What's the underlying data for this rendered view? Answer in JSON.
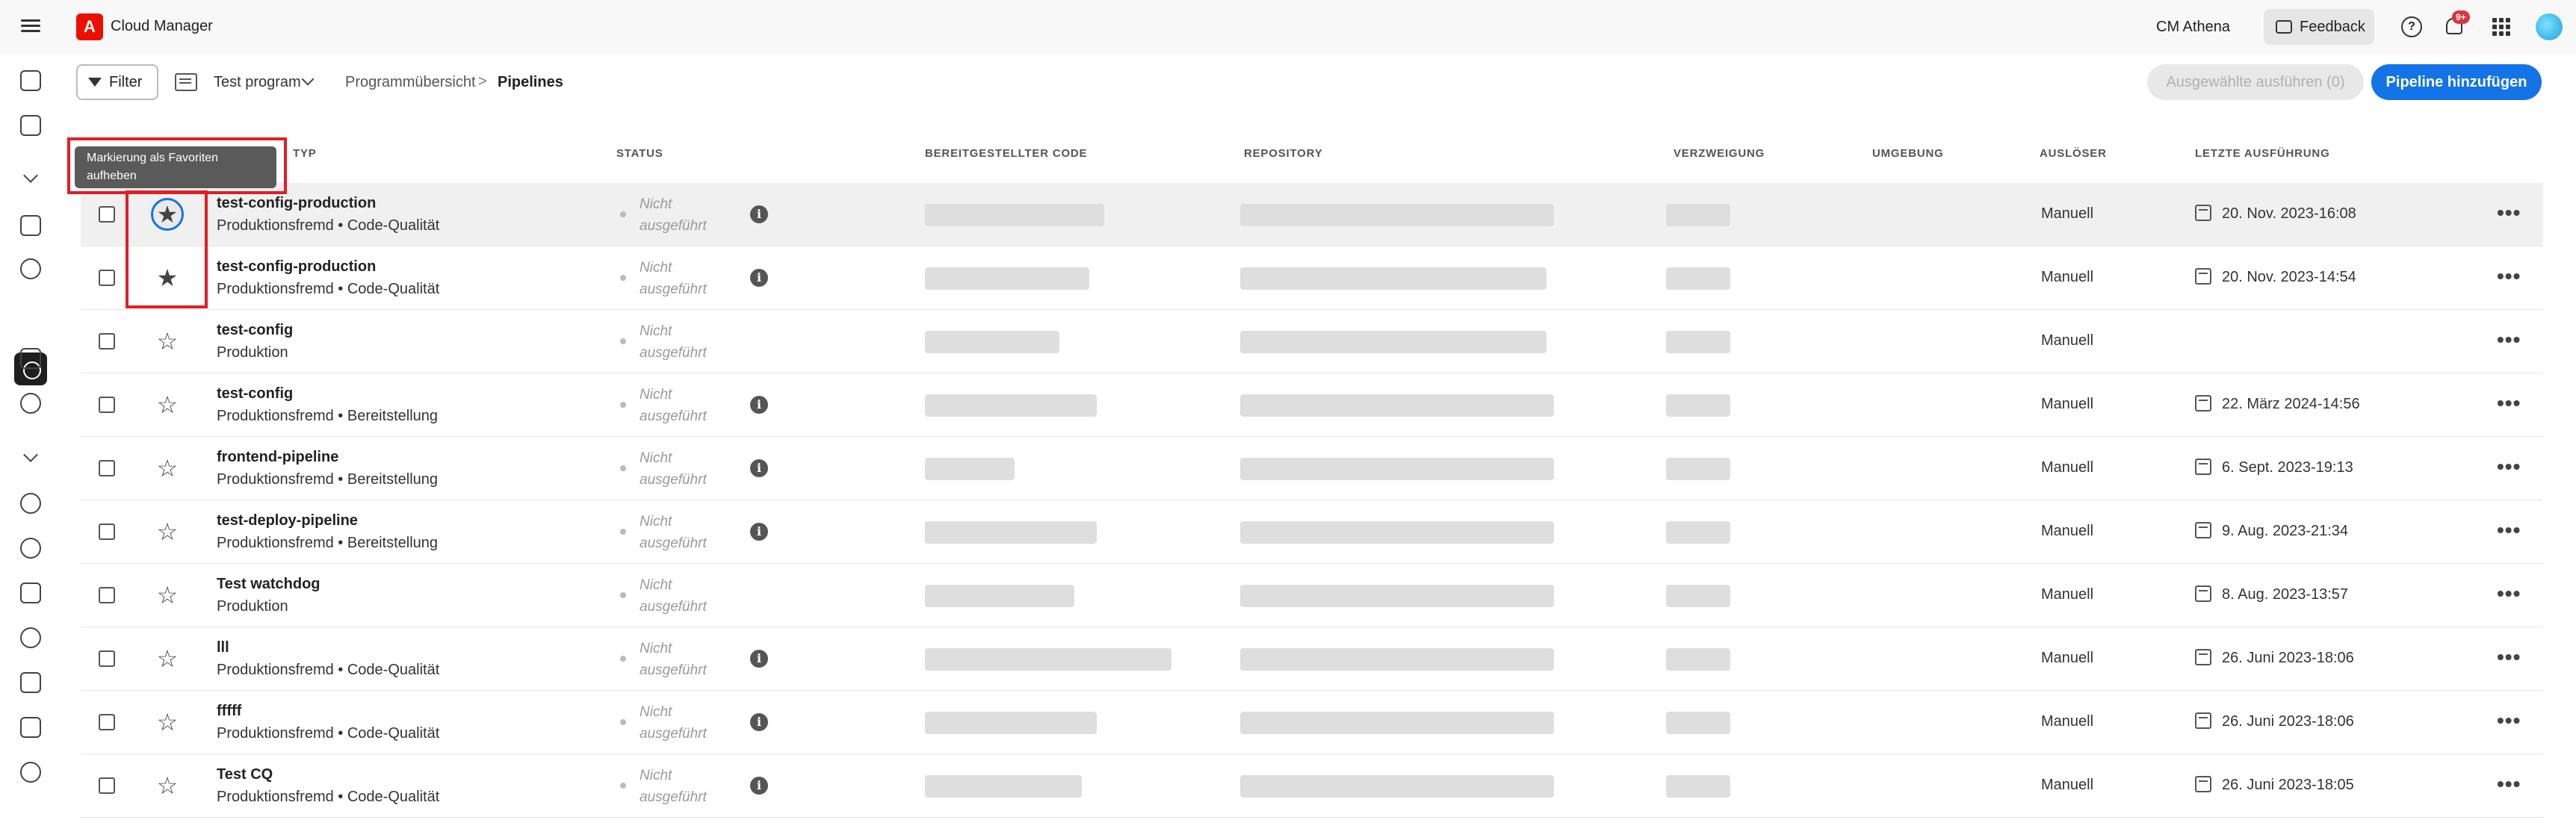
{
  "header": {
    "app_title": "Cloud Manager",
    "org_name": "CM Athena",
    "feedback_label": "Feedback",
    "notification_badge": "9+"
  },
  "toolbar": {
    "filter_label": "Filter",
    "program_name": "Test program",
    "breadcrumb_parent": "Programmübersicht",
    "breadcrumb_separator": ">",
    "breadcrumb_current": "Pipelines",
    "run_selected_label": "Ausgewählte ausführen (0)",
    "add_pipeline_label": "Pipeline hinzufügen"
  },
  "tooltip": {
    "text": "Markierung als Favoriten aufheben"
  },
  "table": {
    "columns": {
      "type": "TYP",
      "status": "STATUS",
      "deployed_code": "BEREITGESTELLTER CODE",
      "repository": "REPOSITORY",
      "branch": "VERZWEIGUNG",
      "environment": "UMGEBUNG",
      "trigger": "AUSLÖSER",
      "last_run": "LETZTE AUSFÜHRUNG"
    },
    "rows": [
      {
        "name": "test-config-production",
        "type": "Produktionsfremd • Code-Qualität",
        "status": "Nicht ausgeführt",
        "trigger": "Manuell",
        "last_run": "20. Nov. 2023-16:08",
        "favorite": true
      },
      {
        "name": "test-config-production",
        "type": "Produktionsfremd • Code-Qualität",
        "status": "Nicht ausgeführt",
        "trigger": "Manuell",
        "last_run": "20. Nov. 2023-14:54",
        "favorite": true
      },
      {
        "name": "test-config",
        "type": "Produktion",
        "status": "Nicht ausgeführt",
        "trigger": "Manuell",
        "last_run": "",
        "favorite": false
      },
      {
        "name": "test-config",
        "type": "Produktionsfremd • Bereitstellung",
        "status": "Nicht ausgeführt",
        "trigger": "Manuell",
        "last_run": "22. März 2024-14:56",
        "favorite": false
      },
      {
        "name": "frontend-pipeline",
        "type": "Produktionsfremd • Bereitstellung",
        "status": "Nicht ausgeführt",
        "trigger": "Manuell",
        "last_run": "6. Sept. 2023-19:13",
        "favorite": false
      },
      {
        "name": "test-deploy-pipeline",
        "type": "Produktionsfremd • Bereitstellung",
        "status": "Nicht ausgeführt",
        "trigger": "Manuell",
        "last_run": "9. Aug. 2023-21:34",
        "favorite": false
      },
      {
        "name": "Test watchdog",
        "type": "Produktion",
        "status": "Nicht ausgeführt",
        "trigger": "Manuell",
        "last_run": "8. Aug. 2023-13:57",
        "favorite": false
      },
      {
        "name": "lll",
        "type": "Produktionsfremd • Code-Qualität",
        "status": "Nicht ausgeführt",
        "trigger": "Manuell",
        "last_run": "26. Juni 2023-18:06",
        "favorite": false
      },
      {
        "name": "fffff",
        "type": "Produktionsfremd • Code-Qualität",
        "status": "Nicht ausgeführt",
        "trigger": "Manuell",
        "last_run": "26. Juni 2023-18:06",
        "favorite": false
      },
      {
        "name": "Test CQ",
        "type": "Produktionsfremd • Code-Qualität",
        "status": "Nicht ausgeführt",
        "trigger": "Manuell",
        "last_run": "26. Juni 2023-18:05",
        "favorite": false
      }
    ]
  },
  "colors": {
    "accent": "#1473e6",
    "adobe_red": "#eb1000",
    "highlight_red": "#e21d24"
  }
}
